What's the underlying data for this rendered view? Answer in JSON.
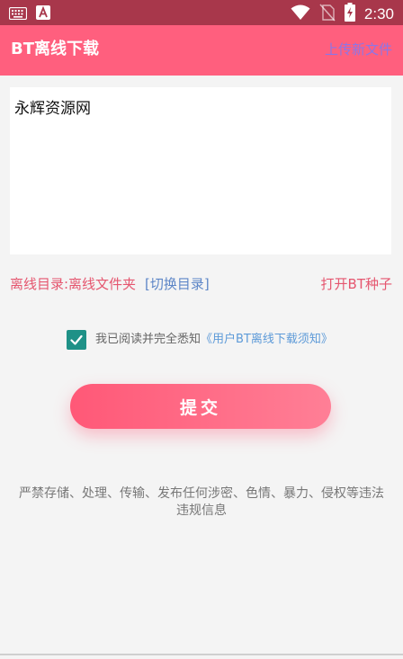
{
  "status_bar": {
    "time": "2:30",
    "left_icons": [
      "keyboard-icon",
      "app-a-icon"
    ],
    "right_icons": [
      "wifi-icon",
      "no-sim-icon",
      "battery-charging-icon"
    ]
  },
  "app_bar": {
    "title": "BT离线下载",
    "action": "上传新文件"
  },
  "editor": {
    "value": "永辉资源网"
  },
  "directory": {
    "label": "离线目录:离线文件夹",
    "switch": "[切换目录]",
    "open_torrent": "打开BT种子"
  },
  "agreement": {
    "checked": true,
    "text": "我已阅读并完全悉知",
    "link": "《用户BT离线下载须知》"
  },
  "submit": {
    "label": "提交"
  },
  "notice": {
    "text": "严禁存储、处理、传输、发布任何涉密、色情、暴力、侵权等违法违规信息"
  },
  "colors": {
    "app_bar": "#ff5f7e",
    "status_bar": "#a8374b",
    "accent_link": "#5d86c7",
    "checkbox": "#1f9187"
  }
}
